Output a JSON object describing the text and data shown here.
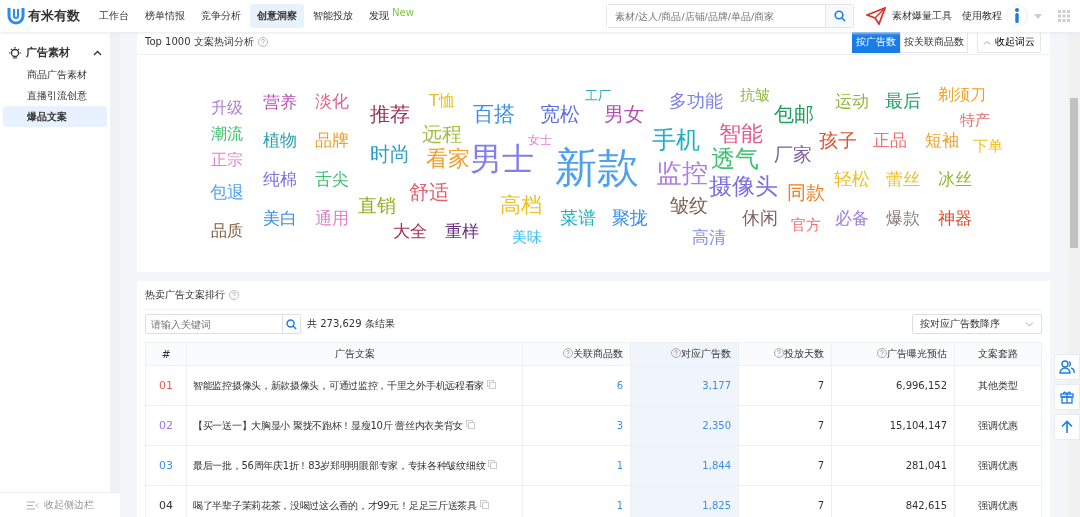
{
  "brand": "有米有数",
  "nav": [
    {
      "label": "工作台",
      "selected": false
    },
    {
      "label": "榜单情报",
      "selected": false
    },
    {
      "label": "竞争分析",
      "selected": false
    },
    {
      "label": "创意洞察",
      "selected": true
    },
    {
      "label": "智能投放",
      "selected": false
    },
    {
      "label": "发现",
      "selected": false,
      "badge": "New"
    }
  ],
  "search": {
    "placeholder": "素材/达人/商品/店铺/品牌/单品/商家"
  },
  "tool_link": "素材爆量工具",
  "tutorial_link": "使用教程",
  "sidebar": {
    "section": "广告素材",
    "expanded": true,
    "items": [
      {
        "label": "商品广告素材",
        "selected": false
      },
      {
        "label": "直播引流创意",
        "selected": false
      },
      {
        "label": "爆品文案",
        "selected": true
      }
    ],
    "collapse": "收起侧边栏"
  },
  "cloud_card": {
    "title": "Top 1000 文案热词分析",
    "sort": [
      {
        "label": "按广告数",
        "selected": true
      },
      {
        "label": "按关联商品数",
        "selected": false
      }
    ],
    "collapse": "收起词云",
    "words": [
      {
        "text": "升级",
        "color": "#b07fd6"
      },
      {
        "text": "营养",
        "color": "#b455b4"
      },
      {
        "text": "淡化",
        "color": "#e0608a"
      },
      {
        "text": "推荐",
        "color": "#a0305a"
      },
      {
        "text": "T恤",
        "color": "#e8c020"
      },
      {
        "text": "百搭",
        "color": "#3a8ee6"
      },
      {
        "text": "宽松",
        "color": "#5a6ee0"
      },
      {
        "text": "工厂",
        "color": "#30b0b0"
      },
      {
        "text": "男女",
        "color": "#b050b0"
      },
      {
        "text": "多功能",
        "color": "#7a80e8"
      },
      {
        "text": "抗皱",
        "color": "#90b840"
      },
      {
        "text": "包邮",
        "color": "#20a060"
      },
      {
        "text": "运动",
        "color": "#90b840"
      },
      {
        "text": "最后",
        "color": "#20a060"
      },
      {
        "text": "剃须刀",
        "color": "#f0a020"
      },
      {
        "text": "特产",
        "color": "#e07070"
      },
      {
        "text": "潮流",
        "color": "#40c070"
      },
      {
        "text": "植物",
        "color": "#2aa0b0"
      },
      {
        "text": "品牌",
        "color": "#f0a030"
      },
      {
        "text": "远程",
        "color": "#a0c040"
      },
      {
        "text": "时尚",
        "color": "#2a9ec0"
      },
      {
        "text": "看家",
        "color": "#f0a030"
      },
      {
        "text": "男士",
        "color": "#8080e8"
      },
      {
        "text": "女士",
        "color": "#e080d0"
      },
      {
        "text": "新款",
        "color": "#50a0f0"
      },
      {
        "text": "手机",
        "color": "#20b0c0"
      },
      {
        "text": "智能",
        "color": "#e05a8a"
      },
      {
        "text": "监控",
        "color": "#b080e0"
      },
      {
        "text": "透气",
        "color": "#40c070"
      },
      {
        "text": "厂家",
        "color": "#8060a0"
      },
      {
        "text": "孩子",
        "color": "#e05030"
      },
      {
        "text": "正品",
        "color": "#f07070"
      },
      {
        "text": "短袖",
        "color": "#f0a020"
      },
      {
        "text": "下单",
        "color": "#f0c020"
      },
      {
        "text": "正宗",
        "color": "#e080d0"
      },
      {
        "text": "纯棉",
        "color": "#8070e0"
      },
      {
        "text": "舌尖",
        "color": "#40c070"
      },
      {
        "text": "摄像头",
        "color": "#7a6ee0"
      },
      {
        "text": "同款",
        "color": "#f08020"
      },
      {
        "text": "轻松",
        "color": "#f0c020"
      },
      {
        "text": "蕾丝",
        "color": "#f0c020"
      },
      {
        "text": "冰丝",
        "color": "#90b830"
      },
      {
        "text": "包退",
        "color": "#50a0f0"
      },
      {
        "text": "直销",
        "color": "#90b020"
      },
      {
        "text": "舒适",
        "color": "#e06070"
      },
      {
        "text": "高档",
        "color": "#f0c020"
      },
      {
        "text": "皱纹",
        "color": "#806050"
      },
      {
        "text": "美白",
        "color": "#3a8ee6"
      },
      {
        "text": "通用",
        "color": "#e080d0"
      },
      {
        "text": "菜谱",
        "color": "#20b0c0"
      },
      {
        "text": "聚拢",
        "color": "#3a8ee6"
      },
      {
        "text": "休闲",
        "color": "#806060"
      },
      {
        "text": "官方",
        "color": "#f07070"
      },
      {
        "text": "必备",
        "color": "#a080e0"
      },
      {
        "text": "爆款",
        "color": "#908080"
      },
      {
        "text": "神器",
        "color": "#e05030"
      },
      {
        "text": "品质",
        "color": "#806040"
      },
      {
        "text": "大全",
        "color": "#a03050"
      },
      {
        "text": "重样",
        "color": "#6a3080"
      },
      {
        "text": "美味",
        "color": "#40c0f0"
      },
      {
        "text": "高清",
        "color": "#8090e8"
      }
    ]
  },
  "ranking": {
    "title": "热卖广告文案排行",
    "search_placeholder": "请输入关键词",
    "result_count": "共 273,629 条结果",
    "sort_select": "按对应广告数降序",
    "columns": [
      {
        "label": "#",
        "help": false
      },
      {
        "label": "广告文案",
        "help": false
      },
      {
        "label": "关联商品数",
        "help": true
      },
      {
        "label": "对应广告数",
        "help": true
      },
      {
        "label": "投放天数",
        "help": true
      },
      {
        "label": "广告曝光预估",
        "help": true
      },
      {
        "label": "文案套路",
        "help": false
      }
    ],
    "rows": [
      {
        "rank": "01",
        "color": "#f05a4a",
        "copy": "智能监控摄像头，新款摄像头，可通过监控，千里之外手机远程看家",
        "products": "6",
        "ads": "3,177",
        "days": "7",
        "exposure": "6,996,152",
        "pattern": "其他类型"
      },
      {
        "rank": "02",
        "color": "#a070e0",
        "copy": "【买一送一】大胸显小 聚拢不跑杯！显瘦10斤 蕾丝内衣美背女",
        "products": "3",
        "ads": "2,350",
        "days": "7",
        "exposure": "15,104,147",
        "pattern": "强调优惠"
      },
      {
        "rank": "03",
        "color": "#3a8ee6",
        "copy": "最后一批，56周年庆1折！83岁郑明明眼部专家，专抹各种皱纹细纹",
        "products": "1",
        "ads": "1,844",
        "days": "7",
        "exposure": "281,041",
        "pattern": "强调优惠"
      },
      {
        "rank": "04",
        "color": "#333333",
        "copy": "喝了半辈子茉莉花茶，没喝过这么香的，才99元！足足三斤送茶具",
        "products": "1",
        "ads": "1,825",
        "days": "7",
        "exposure": "842,615",
        "pattern": "强调优惠"
      }
    ]
  }
}
